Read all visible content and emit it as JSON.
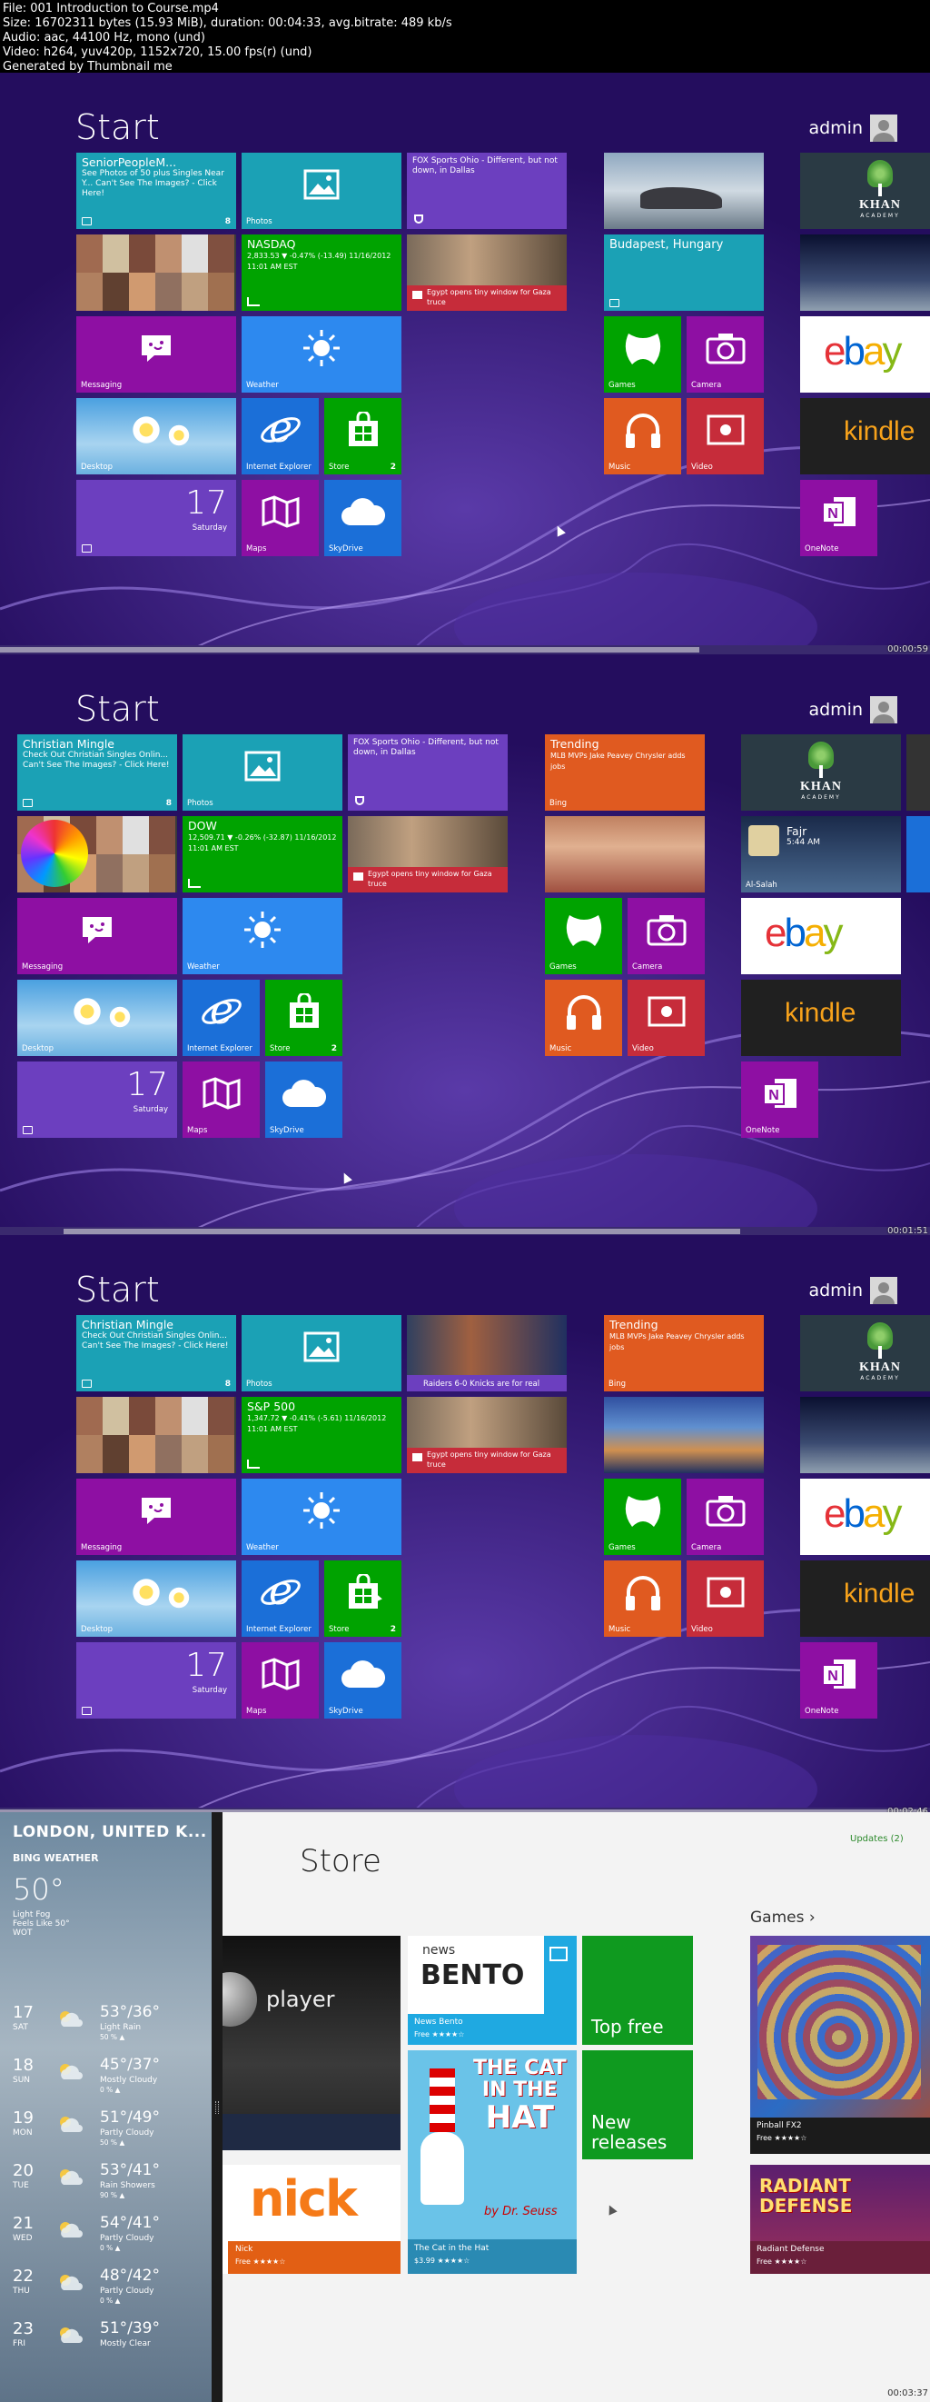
{
  "header": {
    "lines": [
      "File: 001 Introduction to Course.mp4",
      "Size: 16702311 bytes (15.93 MiB), duration: 00:04:33, avg.bitrate: 489 kb/s",
      "Audio: aac, 44100 Hz, mono (und)",
      "Video: h264, yuv420p, 1152x720, 15.00 fps(r) (und)",
      "Generated by Thumbnail me"
    ]
  },
  "start_title": "Start",
  "user_name": "admin",
  "colors": {
    "bg": "#240d5e",
    "cyan": "#1ba1b5",
    "green": "#00a300",
    "purple": "#8e0fa3",
    "blue": "#2d89ef",
    "orange": "#e05a20",
    "violet": "#6c3fbf",
    "red": "#c62c3a"
  },
  "frames": [
    {
      "timestamp": "00:00:59",
      "tiles": {
        "people_title": "SeniorPeopleM...",
        "people_text": "See Photos of 50 plus Singles Near Y... Can't See The Images? - Click Here!",
        "people_badge": "8",
        "photos": "Photos",
        "sports_text": "FOX Sports Ohio - Different, but not down, in Dallas",
        "stock_title": "NASDAQ",
        "stock_text": "2,833.53 ▼ -0.47% (-13.49) 11/16/2012 11:01 AM EST",
        "news_text": "Egypt opens tiny window for Gaza truce",
        "messaging": "Messaging",
        "weather": "Weather",
        "desktop": "Desktop",
        "ie": "Internet Explorer",
        "store": "Store",
        "store_badge": "2",
        "cal_num": "17",
        "cal_day": "Saturday",
        "maps": "Maps",
        "skydrive": "SkyDrive",
        "travel_text": "Budapest, Hungary",
        "games": "Games",
        "camera": "Camera",
        "music": "Music",
        "video": "Video",
        "onenote": "OneNote"
      }
    },
    {
      "timestamp": "00:01:51",
      "tiles": {
        "people_title": "Christian    Mingle",
        "people_text": "Check Out Christian   Singles Onlin... Can't See The Images? - Click Here!",
        "people_badge": "8",
        "photos": "Photos",
        "sports_text": "FOX Sports Ohio - Different, but not down, in Dallas",
        "stock_title": "DOW",
        "stock_text": "12,509.71 ▼ -0.26% (-32.87) 11/16/2012 11:01 AM EST",
        "news_text": "Egypt opens tiny window for Gaza truce",
        "messaging": "Messaging",
        "weather": "Weather",
        "desktop": "Desktop",
        "ie": "Internet Explorer",
        "store": "Store",
        "store_badge": "2",
        "cal_num": "17",
        "cal_day": "Saturday",
        "maps": "Maps",
        "skydrive": "SkyDrive",
        "bing_title": "Trending",
        "bing_text": "MLB MVPs Jake Peavey Chrysler adds jobs",
        "bing": "Bing",
        "games": "Games",
        "camera": "Camera",
        "music": "Music",
        "video": "Video",
        "alsalah_title": "Fajr",
        "alsalah_time": "5:44 AM",
        "alsalah": "Al-Salah",
        "onenote": "OneNote"
      }
    },
    {
      "timestamp": "00:02:46",
      "tiles": {
        "people_title": "Christian    Mingle",
        "people_text": "Check Out Christian   Singles Onlin... Can't See The Images? - Click Here!",
        "people_badge": "8",
        "photos": "Photos",
        "sports_text": "Raiders 6-0 Knicks are for real",
        "stock_title": "S&P 500",
        "stock_text": "1,347.72 ▼ -0.41% (-5.61) 11/16/2012 11:01 AM EST",
        "news_text": "Egypt opens tiny window for Gaza truce",
        "messaging": "Messaging",
        "weather": "Weather",
        "desktop": "Desktop",
        "ie": "Internet Explorer",
        "store": "Store",
        "store_badge": "2",
        "cal_num": "17",
        "cal_day": "Saturday",
        "maps": "Maps",
        "skydrive": "SkyDrive",
        "bing_title": "Trending",
        "bing_text": "MLB MVPs Jake Peavey Chrysler adds jobs",
        "bing": "Bing",
        "games": "Games",
        "camera": "Camera",
        "music": "Music",
        "video": "Video",
        "onenote": "OneNote"
      }
    }
  ],
  "store": {
    "timestamp": "00:03:37",
    "title": "Store",
    "updates": "Updates (2)",
    "games_head": "Games ›",
    "weather": {
      "city": "LONDON, UNITED K...",
      "brand": "BING WEATHER",
      "temp": "50°",
      "cond1": "Light Fog",
      "cond2": "Feels Like 50°",
      "cond3": "WOT",
      "days": [
        {
          "num": "17",
          "wd": "SAT",
          "hl": "53°/36°",
          "desc": "Light Rain",
          "pr": "50 % ▲"
        },
        {
          "num": "18",
          "wd": "SUN",
          "hl": "45°/37°",
          "desc": "Mostly Cloudy",
          "pr": "0 % ▲"
        },
        {
          "num": "19",
          "wd": "MON",
          "hl": "51°/49°",
          "desc": "Partly Cloudy",
          "pr": "50 % ▲"
        },
        {
          "num": "20",
          "wd": "TUE",
          "hl": "53°/41°",
          "desc": "Rain Showers",
          "pr": "90 % ▲"
        },
        {
          "num": "21",
          "wd": "WED",
          "hl": "54°/41°",
          "desc": "Partly Cloudy",
          "pr": "0 % ▲"
        },
        {
          "num": "22",
          "wd": "THU",
          "hl": "48°/42°",
          "desc": "Partly Cloudy",
          "pr": "0 % ▲"
        },
        {
          "num": "23",
          "wd": "FRI",
          "hl": "51°/39°",
          "desc": "Mostly Clear",
          "pr": ""
        }
      ]
    },
    "apps": {
      "player": "player",
      "news_name": "News Bento",
      "news_price": "Free ★★★★☆",
      "bento_small": "news",
      "bento_big": "BENTO",
      "top_free": "Top free",
      "new_releases": "New releases",
      "cat_line1": "THE CAT",
      "cat_line2": "IN THE",
      "cat_line3": "HAT",
      "cat_author": "by Dr. Seuss",
      "cat_name": "The Cat in the Hat",
      "cat_price": "$3.99 ★★★★☆",
      "nick_logo": "nick",
      "nick_name": "Nick",
      "nick_price": "Free ★★★★☆",
      "pinball_name": "Pinball FX2",
      "pinball_price": "Free ★★★★☆",
      "radiant_logo": "RADIANT DEFENSE",
      "radiant_name": "Radiant Defense",
      "radiant_price": "Free ★★★★☆"
    }
  }
}
